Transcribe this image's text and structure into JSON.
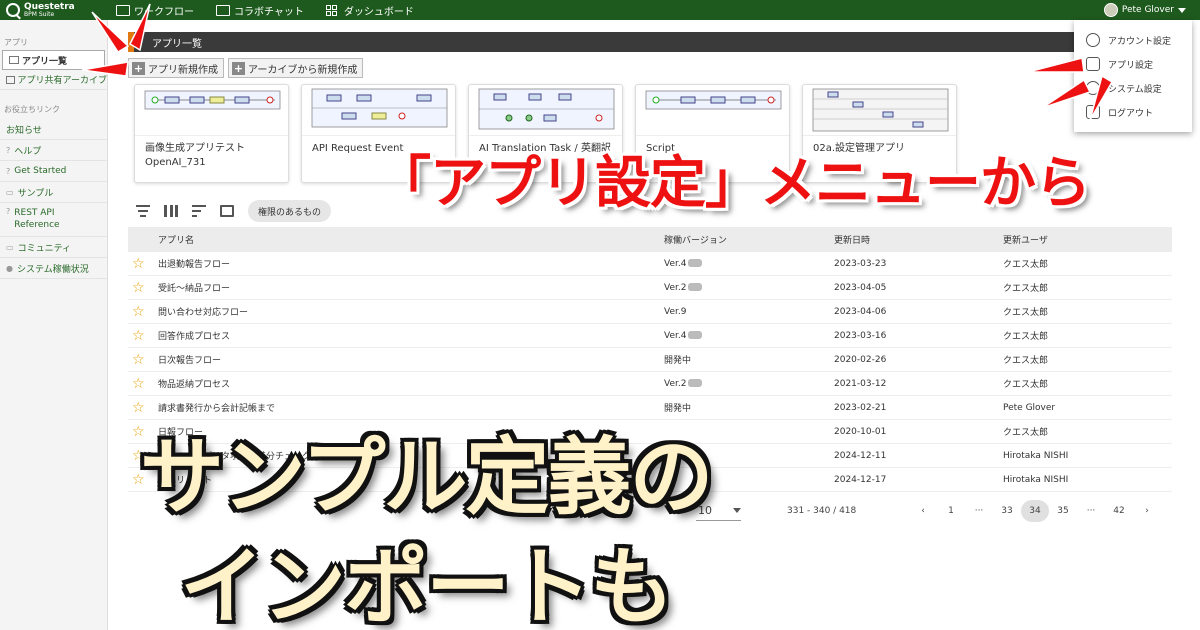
{
  "app": {
    "logo_title": "Questetra",
    "logo_subtitle": "BPM Suite",
    "nav": [
      "ワークフロー",
      "コラボチャット",
      "ダッシュボード"
    ],
    "user_name": "Pete Glover"
  },
  "sidebar": {
    "header": "アプリ",
    "items": [
      {
        "label": "アプリ一覧"
      },
      {
        "label": "アプリ共有アーカイブ"
      }
    ],
    "links_header": "お役立ちリンク",
    "links": [
      "お知らせ",
      "ヘルプ",
      "Get Started",
      "サンプル",
      "REST API Reference",
      "コミュニティ",
      "システム稼働状況"
    ]
  },
  "main": {
    "title": "アプリ一覧",
    "btn_new": "アプリ新規作成",
    "btn_archive": "アーカイブから新規作成",
    "cards": [
      {
        "name": "画像生成アプリテスト OpenAI_731"
      },
      {
        "name": "API Request Event"
      },
      {
        "name": "AI Translation Task / 英翻訳"
      },
      {
        "name": "Script"
      },
      {
        "name": "02a.設定管理アプリ"
      }
    ],
    "filter_chip": "権限のあるもの",
    "columns": [
      "アプリ名",
      "稼働バージョン",
      "更新日時",
      "更新ユーザ"
    ],
    "rows": [
      {
        "name": "出退勤報告フロー",
        "version": "Ver.4",
        "badge": true,
        "date": "2023-03-23",
        "user": "クエス太郎"
      },
      {
        "name": "受託～納品フロー",
        "version": "Ver.2",
        "badge": true,
        "date": "2023-04-05",
        "user": "クエス太郎"
      },
      {
        "name": "問い合わせ対応フロー",
        "version": "Ver.9",
        "badge": false,
        "date": "2023-04-06",
        "user": "クエス太郎"
      },
      {
        "name": "回答作成プロセス",
        "version": "Ver.4",
        "badge": true,
        "date": "2023-03-16",
        "user": "クエス太郎"
      },
      {
        "name": "日次報告フロー",
        "version": "開発中",
        "badge": false,
        "date": "2020-02-26",
        "user": "クエス太郎"
      },
      {
        "name": "物品返納プロセス",
        "version": "Ver.2",
        "badge": true,
        "date": "2021-03-12",
        "user": "クエス太郎"
      },
      {
        "name": "請求書発行から会計記帳まで",
        "version": "開発中",
        "badge": false,
        "date": "2023-02-21",
        "user": "Pete Glover"
      },
      {
        "name": "日報フロー",
        "version": "",
        "badge": false,
        "date": "2020-10-01",
        "user": "クエス太郎"
      },
      {
        "name": "二つの文書データ項目の差分チェック (Diff)",
        "version": "",
        "badge": false,
        "date": "2024-12-11",
        "user": "Hirotaka NISHI"
      },
      {
        "name": "ヒヤリハット",
        "version": "",
        "badge": false,
        "date": "2024-12-17",
        "user": "Hirotaka NISHI"
      }
    ],
    "pager": {
      "size": "10",
      "range": "331 - 340 / 418",
      "pages": [
        "‹",
        "1",
        "···",
        "33",
        "34",
        "35",
        "···",
        "42",
        "›"
      ],
      "current": "34"
    }
  },
  "menu": {
    "items": [
      "アカウント設定",
      "アプリ設定",
      "システム設定",
      "ログアウト"
    ]
  },
  "overlay": {
    "red": "「アプリ設定」メニューから",
    "line1": "サンプル定義の",
    "line2": "インポートも"
  },
  "colors": {
    "topbar": "#1e5a1e",
    "accent_orange": "#e07a10",
    "overlay_red": "#e11111",
    "arrow_red": "#ee1111",
    "star": "#e8a200"
  }
}
